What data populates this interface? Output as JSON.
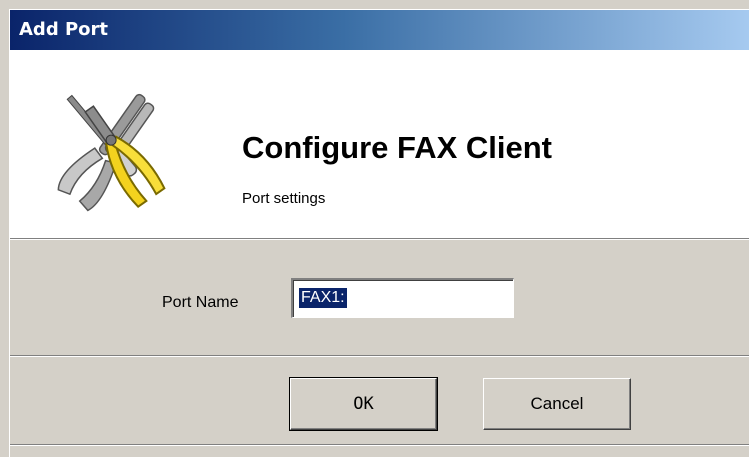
{
  "window": {
    "title": "Add Port"
  },
  "header": {
    "logo_icon": "tools-pliers-icon",
    "title": "Configure FAX Client",
    "subtitle": "Port settings"
  },
  "form": {
    "port_name_label": "Port Name",
    "port_name_value": "FAX1:"
  },
  "buttons": {
    "ok_label": "OK",
    "cancel_label": "Cancel"
  },
  "colors": {
    "title_gradient_start": "#0a246a",
    "title_gradient_end": "#a6caf0",
    "face": "#d4d0c8",
    "selection": "#0a246a"
  }
}
